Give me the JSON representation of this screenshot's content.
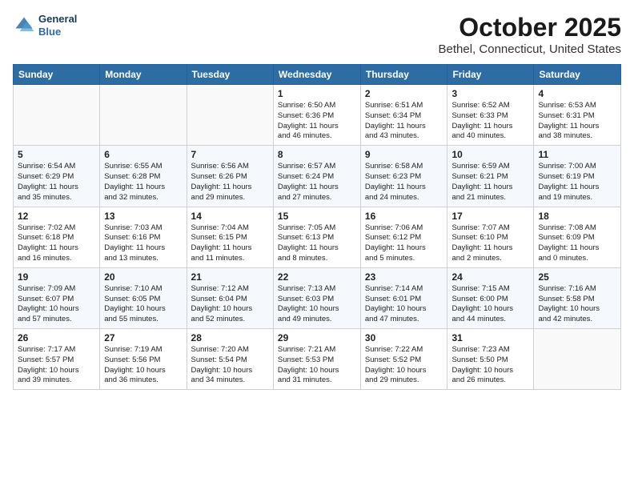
{
  "header": {
    "logo_line1": "General",
    "logo_line2": "Blue",
    "month_year": "October 2025",
    "location": "Bethel, Connecticut, United States"
  },
  "weekdays": [
    "Sunday",
    "Monday",
    "Tuesday",
    "Wednesday",
    "Thursday",
    "Friday",
    "Saturday"
  ],
  "weeks": [
    [
      {
        "day": "",
        "info": ""
      },
      {
        "day": "",
        "info": ""
      },
      {
        "day": "",
        "info": ""
      },
      {
        "day": "1",
        "info": "Sunrise: 6:50 AM\nSunset: 6:36 PM\nDaylight: 11 hours\nand 46 minutes."
      },
      {
        "day": "2",
        "info": "Sunrise: 6:51 AM\nSunset: 6:34 PM\nDaylight: 11 hours\nand 43 minutes."
      },
      {
        "day": "3",
        "info": "Sunrise: 6:52 AM\nSunset: 6:33 PM\nDaylight: 11 hours\nand 40 minutes."
      },
      {
        "day": "4",
        "info": "Sunrise: 6:53 AM\nSunset: 6:31 PM\nDaylight: 11 hours\nand 38 minutes."
      }
    ],
    [
      {
        "day": "5",
        "info": "Sunrise: 6:54 AM\nSunset: 6:29 PM\nDaylight: 11 hours\nand 35 minutes."
      },
      {
        "day": "6",
        "info": "Sunrise: 6:55 AM\nSunset: 6:28 PM\nDaylight: 11 hours\nand 32 minutes."
      },
      {
        "day": "7",
        "info": "Sunrise: 6:56 AM\nSunset: 6:26 PM\nDaylight: 11 hours\nand 29 minutes."
      },
      {
        "day": "8",
        "info": "Sunrise: 6:57 AM\nSunset: 6:24 PM\nDaylight: 11 hours\nand 27 minutes."
      },
      {
        "day": "9",
        "info": "Sunrise: 6:58 AM\nSunset: 6:23 PM\nDaylight: 11 hours\nand 24 minutes."
      },
      {
        "day": "10",
        "info": "Sunrise: 6:59 AM\nSunset: 6:21 PM\nDaylight: 11 hours\nand 21 minutes."
      },
      {
        "day": "11",
        "info": "Sunrise: 7:00 AM\nSunset: 6:19 PM\nDaylight: 11 hours\nand 19 minutes."
      }
    ],
    [
      {
        "day": "12",
        "info": "Sunrise: 7:02 AM\nSunset: 6:18 PM\nDaylight: 11 hours\nand 16 minutes."
      },
      {
        "day": "13",
        "info": "Sunrise: 7:03 AM\nSunset: 6:16 PM\nDaylight: 11 hours\nand 13 minutes."
      },
      {
        "day": "14",
        "info": "Sunrise: 7:04 AM\nSunset: 6:15 PM\nDaylight: 11 hours\nand 11 minutes."
      },
      {
        "day": "15",
        "info": "Sunrise: 7:05 AM\nSunset: 6:13 PM\nDaylight: 11 hours\nand 8 minutes."
      },
      {
        "day": "16",
        "info": "Sunrise: 7:06 AM\nSunset: 6:12 PM\nDaylight: 11 hours\nand 5 minutes."
      },
      {
        "day": "17",
        "info": "Sunrise: 7:07 AM\nSunset: 6:10 PM\nDaylight: 11 hours\nand 2 minutes."
      },
      {
        "day": "18",
        "info": "Sunrise: 7:08 AM\nSunset: 6:09 PM\nDaylight: 11 hours\nand 0 minutes."
      }
    ],
    [
      {
        "day": "19",
        "info": "Sunrise: 7:09 AM\nSunset: 6:07 PM\nDaylight: 10 hours\nand 57 minutes."
      },
      {
        "day": "20",
        "info": "Sunrise: 7:10 AM\nSunset: 6:05 PM\nDaylight: 10 hours\nand 55 minutes."
      },
      {
        "day": "21",
        "info": "Sunrise: 7:12 AM\nSunset: 6:04 PM\nDaylight: 10 hours\nand 52 minutes."
      },
      {
        "day": "22",
        "info": "Sunrise: 7:13 AM\nSunset: 6:03 PM\nDaylight: 10 hours\nand 49 minutes."
      },
      {
        "day": "23",
        "info": "Sunrise: 7:14 AM\nSunset: 6:01 PM\nDaylight: 10 hours\nand 47 minutes."
      },
      {
        "day": "24",
        "info": "Sunrise: 7:15 AM\nSunset: 6:00 PM\nDaylight: 10 hours\nand 44 minutes."
      },
      {
        "day": "25",
        "info": "Sunrise: 7:16 AM\nSunset: 5:58 PM\nDaylight: 10 hours\nand 42 minutes."
      }
    ],
    [
      {
        "day": "26",
        "info": "Sunrise: 7:17 AM\nSunset: 5:57 PM\nDaylight: 10 hours\nand 39 minutes."
      },
      {
        "day": "27",
        "info": "Sunrise: 7:19 AM\nSunset: 5:56 PM\nDaylight: 10 hours\nand 36 minutes."
      },
      {
        "day": "28",
        "info": "Sunrise: 7:20 AM\nSunset: 5:54 PM\nDaylight: 10 hours\nand 34 minutes."
      },
      {
        "day": "29",
        "info": "Sunrise: 7:21 AM\nSunset: 5:53 PM\nDaylight: 10 hours\nand 31 minutes."
      },
      {
        "day": "30",
        "info": "Sunrise: 7:22 AM\nSunset: 5:52 PM\nDaylight: 10 hours\nand 29 minutes."
      },
      {
        "day": "31",
        "info": "Sunrise: 7:23 AM\nSunset: 5:50 PM\nDaylight: 10 hours\nand 26 minutes."
      },
      {
        "day": "",
        "info": ""
      }
    ]
  ]
}
